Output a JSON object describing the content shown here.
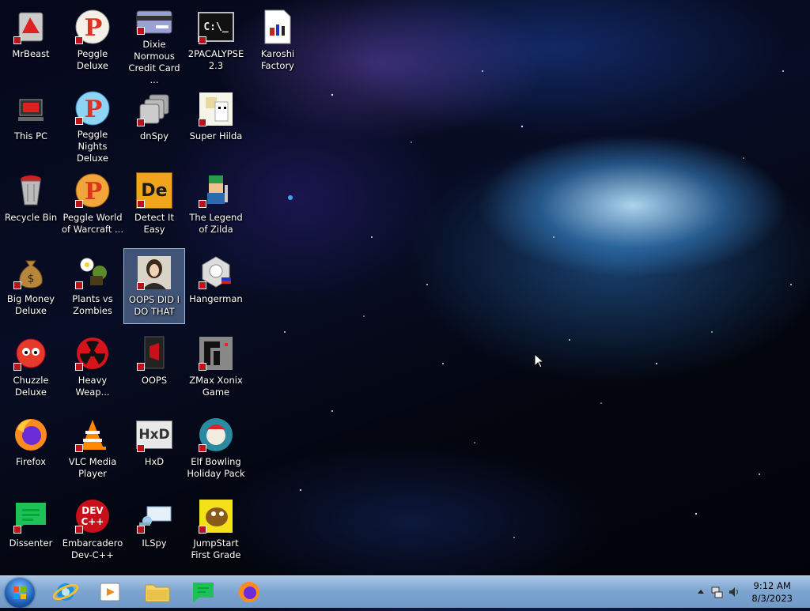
{
  "desktop": {
    "icons": [
      {
        "label": "MrBeast"
      },
      {
        "label": "Peggle Deluxe"
      },
      {
        "label": "Dixie Normous Credit Card ..."
      },
      {
        "label": "2PACALYPSE 2.3"
      },
      {
        "label": "Karoshi Factory"
      },
      {
        "label": "This PC"
      },
      {
        "label": "Peggle Nights Deluxe"
      },
      {
        "label": "dnSpy"
      },
      {
        "label": "Super Hilda"
      },
      {
        "label": "Recycle Bin"
      },
      {
        "label": "Peggle World of Warcraft ..."
      },
      {
        "label": "Detect It Easy"
      },
      {
        "label": "The Legend of Zilda"
      },
      {
        "label": "Big Money Deluxe"
      },
      {
        "label": "Plants vs Zombies"
      },
      {
        "label": "OOPS DID I DO THAT"
      },
      {
        "label": "Hangerman"
      },
      {
        "label": "Chuzzle Deluxe"
      },
      {
        "label": "Heavy Weap..."
      },
      {
        "label": "OOPS"
      },
      {
        "label": "ZMax Xonix Game"
      },
      {
        "label": "Firefox"
      },
      {
        "label": "VLC Media Player"
      },
      {
        "label": "HxD"
      },
      {
        "label": "Elf Bowling Holiday Pack"
      },
      {
        "label": "Dissenter"
      },
      {
        "label": "Embarcadero Dev-C++"
      },
      {
        "label": "ILSpy"
      },
      {
        "label": "JumpStart First Grade"
      }
    ],
    "icon_glyphs": {
      "detect_it_easy": "De",
      "dev_cpp": "DEV C++",
      "console": "C:\\_",
      "hxd": "HxD"
    }
  },
  "taskbar": {
    "clock_time": "9:12 AM",
    "clock_date": "8/3/2023",
    "pinned": [
      "internet-explorer",
      "media-player",
      "file-explorer",
      "dissenter",
      "firefox"
    ]
  }
}
